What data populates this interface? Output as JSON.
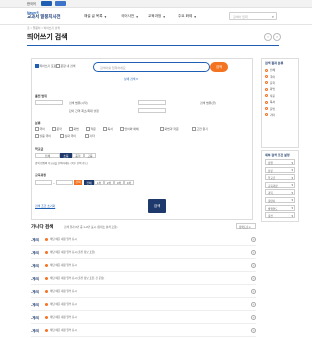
{
  "topbar": {
    "lang": "한국어",
    "items": [
      "",
      ""
    ]
  },
  "header": {
    "logo_line1": "Naver®",
    "logo_line2": "교과서 말뭉치사전",
    "nav": [
      "해설 글 목록",
      "국어사전",
      "교육과정",
      "주요 화제"
    ],
    "search_placeholder": "검색어 입력"
  },
  "breadcrumb": "홈 > 말뭉치 > 띄어쓰기 검색",
  "page_title": "띄어쓰기 검색",
  "form": {
    "options": [
      "띄어쓰기 포함",
      "문장 내 검색"
    ],
    "search_placeholder": "검색어를 입력하세요",
    "search_button": "검색",
    "detail_toggle": "상세 검색 ▾",
    "range_label": "출전 범위",
    "range_fields": [
      "검색 범위(시작)",
      "검색 범위(끝)"
    ],
    "range_sub": "단어 간격 최소/최대 설정",
    "cat_label": "분류",
    "categories": [
      "국어",
      "문학",
      "화법",
      "작문",
      "독서",
      "언어와 매체",
      "화법과 작문",
      "고전 읽기",
      "실용 국어",
      "심화 국어",
      "기타"
    ],
    "level_label": "학교급",
    "levels": [
      "전체",
      "초등",
      "중학",
      "고등"
    ],
    "level_note": "검색 범위의 학교급을 선택하세요. (복수 선택 가능)",
    "period_label": "교육과정",
    "period_button": "선택",
    "periods": [
      "전체",
      "1차",
      "2차",
      "3차",
      "4차"
    ],
    "reset_link": "검색 조건 초기화",
    "submit": "검색"
  },
  "sidebar": {
    "title": "검색 결과 분류",
    "items": [
      "전체",
      "국어",
      "문학",
      "화법",
      "작문",
      "독서",
      "문법",
      "기타"
    ]
  },
  "sidebar2": {
    "title": "세부 검색 조건 설정",
    "fields": [
      "정렬",
      "분류",
      "학교급",
      "교육과정",
      "과목",
      "출판사",
      "발행연도",
      "출전"
    ]
  },
  "results": {
    "title": "가나다 검색",
    "note": "검색 결과 8건 중 1~8건 표시 (형태소 분석 포함)",
    "sort": "정확도순 ▾",
    "rows": [
      {
        "tag": "-게/되",
        "text": "해당 예문 내용 일부 표시"
      },
      {
        "tag": "-게/되",
        "text": "해당 예문 내용 일부 표시 (출전 정보 포함)"
      },
      {
        "tag": "-게/되",
        "text": "해당 예문 내용 일부 표시"
      },
      {
        "tag": "-게/되",
        "text": "해당 예문 내용 일부 표시 (출전 정보 포함, 긴 문장)"
      },
      {
        "tag": "-게/되",
        "text": "해당 예문 내용 일부 표시"
      },
      {
        "tag": "-게/되",
        "text": "해당 예문 내용 일부 표시"
      },
      {
        "tag": "-게/되",
        "text": "해당 예문 내용 일부 표시"
      },
      {
        "tag": "-게/되",
        "text": "해당 예문 내용 일부 표시"
      }
    ]
  },
  "colors": {
    "accent": "#1e5fb4",
    "navy": "#1e3a6c",
    "orange": "#f37321"
  }
}
